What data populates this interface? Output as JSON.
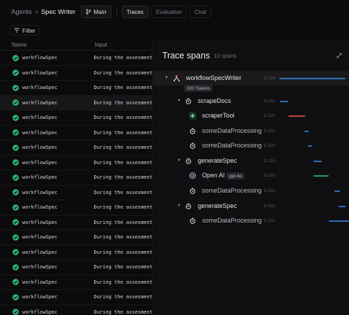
{
  "header": {
    "breadcrumb_parent": "Agents",
    "breadcrumb_separator": ">",
    "breadcrumb_current": "Spec Writer",
    "branch_label": "Main",
    "tabs": [
      {
        "label": "Traces",
        "active": true
      },
      {
        "label": "Evaluation",
        "active": false
      },
      {
        "label": "Chat",
        "active": false
      }
    ]
  },
  "filter": {
    "label": "Filter"
  },
  "table": {
    "columns": {
      "name": "Name",
      "input": "Input"
    },
    "rows": [
      {
        "name": "workflowSpec",
        "input": "During the assesment",
        "status": "success"
      },
      {
        "name": "workflowSpec",
        "input": "During the assesment",
        "status": "success"
      },
      {
        "name": "workflowSpec",
        "input": "During the assesment",
        "status": "success"
      },
      {
        "name": "workflowSpec",
        "input": "During the assesment",
        "status": "success",
        "selected": true
      },
      {
        "name": "workflowSpec",
        "input": "During the assesment",
        "status": "success"
      },
      {
        "name": "workflowSpec",
        "input": "During the assesment",
        "status": "success"
      },
      {
        "name": "workflowSpec",
        "input": "During the assesment",
        "status": "success"
      },
      {
        "name": "workflowSpec",
        "input": "During the assesment",
        "status": "success"
      },
      {
        "name": "workflowSpec",
        "input": "During the assesment",
        "status": "success"
      },
      {
        "name": "workflowSpec",
        "input": "During the assesment",
        "status": "success"
      },
      {
        "name": "workflowSpec",
        "input": "During the assesment",
        "status": "success"
      },
      {
        "name": "workflowSpec",
        "input": "During the assesment",
        "status": "success"
      },
      {
        "name": "workflowSpec",
        "input": "During the assesment",
        "status": "success"
      },
      {
        "name": "workflowSpec",
        "input": "During the assesment",
        "status": "success"
      },
      {
        "name": "workflowSpec",
        "input": "During the assesment",
        "status": "success"
      },
      {
        "name": "workflowSpec",
        "input": "During the assesment",
        "status": "success"
      },
      {
        "name": "workflowSpec",
        "input": "During the assesment",
        "status": "success"
      },
      {
        "name": "workflowSpec",
        "input": "During the assesment",
        "status": "success"
      }
    ]
  },
  "trace": {
    "title": "Trace spans",
    "count": "10 spans",
    "tokens": "320 Tokens",
    "spans": [
      {
        "name": "workflowSpecWriter",
        "duration": "0.12s",
        "icon": "agent-icon",
        "bar_color": "#2f6fbf",
        "selected": true
      },
      {
        "name": "scrapeDocs",
        "duration": "0.12s",
        "icon": "function-icon",
        "bar_color": "#2f6fbf"
      },
      {
        "name": "scraperTool",
        "duration": "0.12s",
        "icon": "tool-icon",
        "bar_color": "#c24b3e"
      },
      {
        "name": "someDataProcessing",
        "duration": "0.12s",
        "icon": "function-icon",
        "bar_color": "#2f6fbf"
      },
      {
        "name": "someDataProcessing",
        "duration": "0.12s",
        "icon": "function-icon",
        "bar_color": "#2f6fbf"
      },
      {
        "name": "generateSpec",
        "duration": "0.12s",
        "icon": "function-icon",
        "bar_color": "#2f6fbf"
      },
      {
        "name": "Open AI",
        "model": "gpt-4o",
        "duration": "0.12s",
        "icon": "openai-icon",
        "bar_color": "#2f9e55"
      },
      {
        "name": "someDataProcessing",
        "duration": "0.12s",
        "icon": "function-icon",
        "bar_color": "#2f6fbf"
      },
      {
        "name": "generateSpec",
        "duration": "0.12s",
        "icon": "function-icon",
        "bar_color": "#2f6fbf"
      },
      {
        "name": "someDataProcessing",
        "duration": "0.12s",
        "icon": "function-icon",
        "bar_color": "#2f6fbf"
      }
    ]
  }
}
